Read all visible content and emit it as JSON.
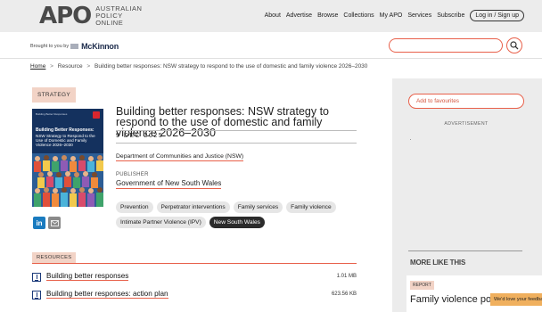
{
  "header": {
    "logo_word": "APO",
    "logo_lines": [
      "AUSTRALIAN",
      "POLICY",
      "ONLINE"
    ],
    "nav": [
      "About",
      "Advertise",
      "Browse",
      "Collections",
      "My APO",
      "Services",
      "Subscribe"
    ],
    "login_label": "Log in / Sign up"
  },
  "sponsor": {
    "brought_by": "Brought to you by",
    "sponsor_name": "McKinnon"
  },
  "search": {
    "placeholder": ""
  },
  "breadcrumb": {
    "home": "Home",
    "resource": "Resource",
    "current": "Building better responses: NSW strategy to respond to the use of domestic and family violence 2026–2030"
  },
  "item": {
    "type_tag": "STRATEGY",
    "title": "Building better responses: NSW strategy to respond to the use of domestic and family violence 2026–2030",
    "date": "9 DEC 2025",
    "department": "Department of Communities and Justice (NSW)",
    "publisher_label": "PUBLISHER",
    "publisher": "Government of New South Wales",
    "tags": [
      {
        "label": "Prevention",
        "active": false
      },
      {
        "label": "Perpetrator interventions",
        "active": false
      },
      {
        "label": "Family services",
        "active": false
      },
      {
        "label": "Family violence",
        "active": false
      },
      {
        "label": "Intimate Partner Violence (IPV)",
        "active": false
      },
      {
        "label": "New South Wales",
        "active": true
      }
    ]
  },
  "cover": {
    "top_text": "Building Better Responses",
    "title": "Building Better Responses:",
    "subtitle": "NSW Strategy to Respond to the Use of Domestic and Family Violence 2026–2030"
  },
  "resources": {
    "label": "RESOURCES",
    "files": [
      {
        "name": "Building better responses",
        "size": "1.01 MB"
      },
      {
        "name": "Building better responses: action plan",
        "size": "623.56 KB"
      }
    ]
  },
  "sidebar": {
    "favourites": "Add to favourites",
    "advert": "ADVERTISEMENT",
    "more_like_this": "MORE LIKE THIS",
    "card_tag": "REPORT",
    "card_title": "Family violence policy legislation and community",
    "feedback": "We'd love your feedback"
  },
  "colors": {
    "accent": "#e8604a",
    "tag_bg": "#f2d3c6",
    "header_bg": "#ececec",
    "cover_bg": "#14315e"
  }
}
